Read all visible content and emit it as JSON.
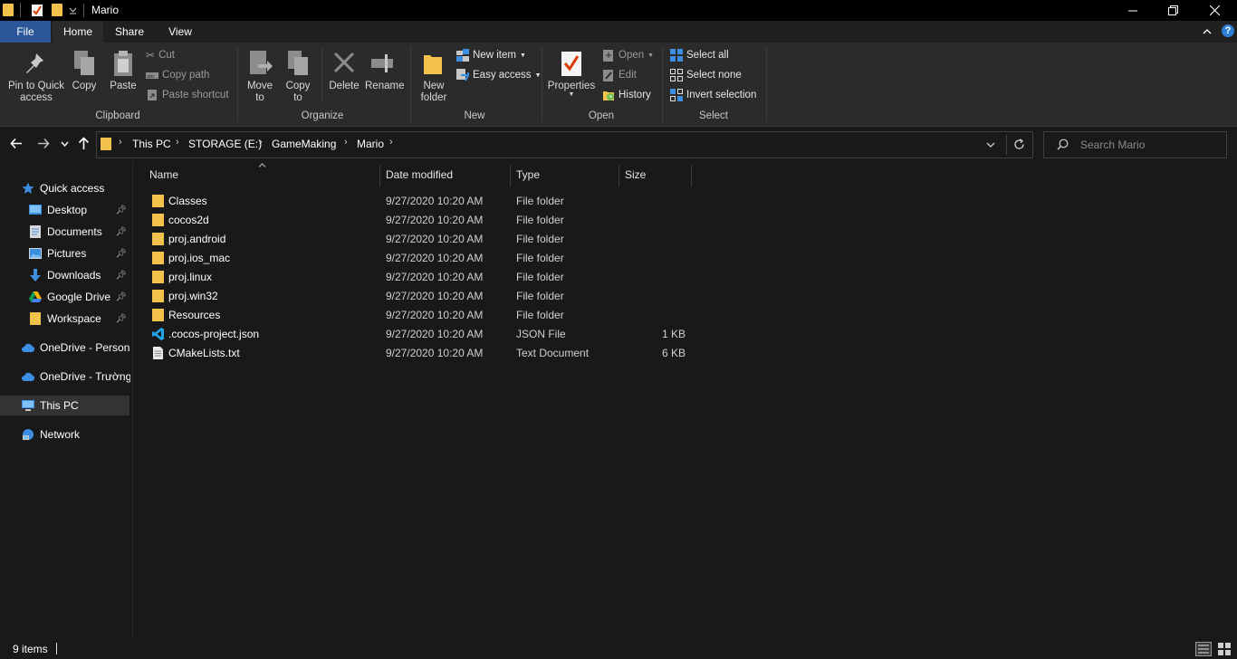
{
  "window": {
    "title": "Mario"
  },
  "colors": {
    "folder": "#f3c24c",
    "file_tab": "#2b579a",
    "accent_blue": "#3c8fe0",
    "vscode_blue": "#23a3e8"
  },
  "ribbon_tabs": [
    "File",
    "Home",
    "Share",
    "View"
  ],
  "ribbon": {
    "clipboard": {
      "pin": "Pin to Quick access",
      "copy": "Copy",
      "paste": "Paste",
      "cut": "Cut",
      "copy_path": "Copy path",
      "paste_shortcut": "Paste shortcut",
      "label": "Clipboard"
    },
    "organize": {
      "move_to": "Move to",
      "copy_to": "Copy to",
      "delete": "Delete",
      "rename": "Rename",
      "label": "Organize"
    },
    "new": {
      "new_folder": "New folder",
      "new_item": "New item",
      "easy_access": "Easy access",
      "label": "New"
    },
    "open": {
      "properties": "Properties",
      "open": "Open",
      "edit": "Edit",
      "history": "History",
      "label": "Open"
    },
    "select": {
      "select_all": "Select all",
      "select_none": "Select none",
      "invert": "Invert selection",
      "label": "Select"
    }
  },
  "breadcrumb": [
    "This PC",
    "STORAGE (E:)",
    "GameMaking",
    "Mario"
  ],
  "search": {
    "placeholder": "Search Mario"
  },
  "nav": [
    {
      "label": "Quick access",
      "icon": "star-icon"
    },
    {
      "label": "Desktop",
      "icon": "desktop-icon",
      "pinned": true
    },
    {
      "label": "Documents",
      "icon": "documents-icon",
      "pinned": true
    },
    {
      "label": "Pictures",
      "icon": "pictures-icon",
      "pinned": true
    },
    {
      "label": "Downloads",
      "icon": "download-icon",
      "pinned": true
    },
    {
      "label": "Google Drive",
      "icon": "google-drive-icon",
      "pinned": true
    },
    {
      "label": "Workspace",
      "icon": "folder-icon",
      "pinned": true
    },
    {
      "label": "OneDrive - Persona",
      "icon": "cloud-icon"
    },
    {
      "label": "OneDrive - Trường",
      "icon": "cloud-icon"
    },
    {
      "label": "This PC",
      "icon": "computer-icon"
    },
    {
      "label": "Network",
      "icon": "network-icon"
    }
  ],
  "columns": [
    "Name",
    "Date modified",
    "Type",
    "Size"
  ],
  "files": [
    {
      "name": "Classes",
      "date": "9/27/2020 10:20 AM",
      "type": "File folder",
      "size": "",
      "icon": "folder-icon"
    },
    {
      "name": "cocos2d",
      "date": "9/27/2020 10:20 AM",
      "type": "File folder",
      "size": "",
      "icon": "folder-icon"
    },
    {
      "name": "proj.android",
      "date": "9/27/2020 10:20 AM",
      "type": "File folder",
      "size": "",
      "icon": "folder-icon"
    },
    {
      "name": "proj.ios_mac",
      "date": "9/27/2020 10:20 AM",
      "type": "File folder",
      "size": "",
      "icon": "folder-icon"
    },
    {
      "name": "proj.linux",
      "date": "9/27/2020 10:20 AM",
      "type": "File folder",
      "size": "",
      "icon": "folder-icon"
    },
    {
      "name": "proj.win32",
      "date": "9/27/2020 10:20 AM",
      "type": "File folder",
      "size": "",
      "icon": "folder-icon"
    },
    {
      "name": "Resources",
      "date": "9/27/2020 10:20 AM",
      "type": "File folder",
      "size": "",
      "icon": "folder-icon"
    },
    {
      "name": ".cocos-project.json",
      "date": "9/27/2020 10:20 AM",
      "type": "JSON File",
      "size": "1 KB",
      "icon": "vscode-file-icon"
    },
    {
      "name": "CMakeLists.txt",
      "date": "9/27/2020 10:20 AM",
      "type": "Text Document",
      "size": "6 KB",
      "icon": "text-file-icon"
    }
  ],
  "status": {
    "items": "9 items"
  }
}
